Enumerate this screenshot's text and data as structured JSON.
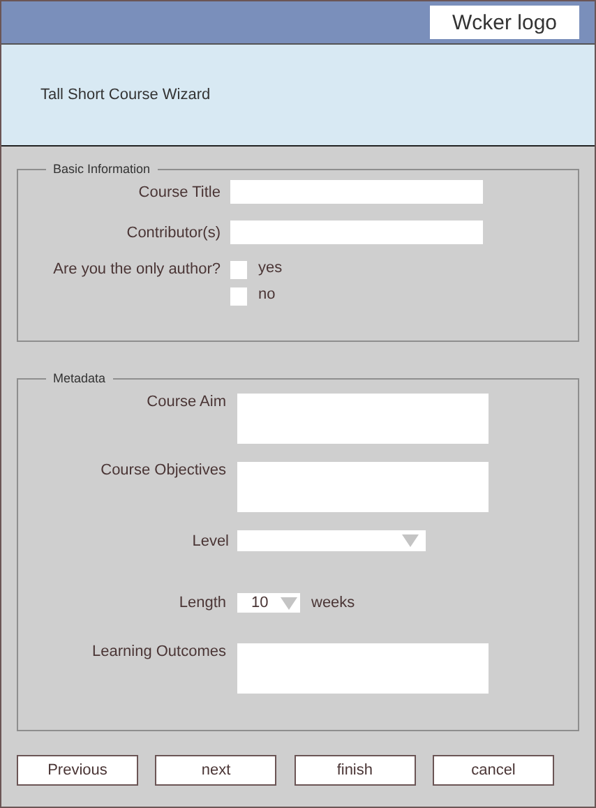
{
  "header": {
    "logo": "Wcker logo"
  },
  "wizard_title": "Tall Short Course Wizard",
  "basic_information": {
    "legend": "Basic Information",
    "fields": [
      {
        "kind": "text",
        "label": "Course Title"
      },
      {
        "kind": "text",
        "label": "Contributor(s)"
      }
    ],
    "only_author": {
      "label": "Are you the only author?",
      "options": [
        {
          "label": "yes",
          "checked": false
        },
        {
          "label": "no",
          "checked": false
        }
      ]
    }
  },
  "metadata": {
    "legend": "Metadata",
    "fields": [
      {
        "kind": "textarea",
        "label": "Course Aim"
      },
      {
        "kind": "textarea",
        "label": "Course Objectives"
      },
      {
        "kind": "select",
        "label": "Level"
      },
      {
        "kind": "number_select",
        "label": "Length",
        "value": "10",
        "unit": "weeks"
      },
      {
        "kind": "textarea",
        "label": "Learning Outcomes"
      }
    ]
  },
  "buttons": [
    "Previous",
    "next",
    "finish",
    "cancel"
  ]
}
